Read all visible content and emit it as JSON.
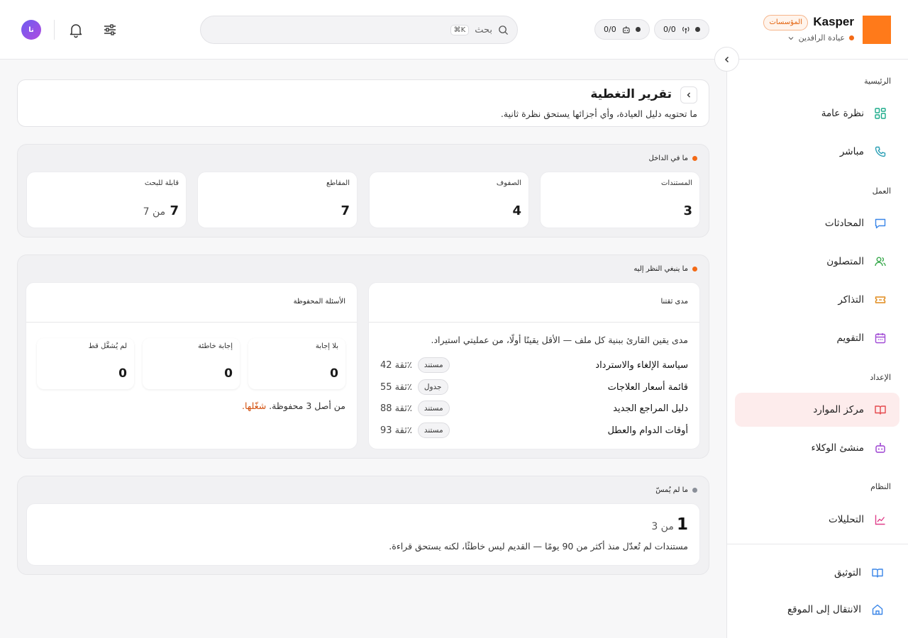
{
  "topbar": {
    "brand_name": "Kasper",
    "brand_badge": "المؤسسات",
    "workspace": "عيادة الرافدين",
    "status": [
      {
        "value": "0/0",
        "icon": "antenna-icon"
      },
      {
        "value": "0/0",
        "icon": "bot-icon"
      }
    ],
    "search_placeholder": "بحث",
    "search_shortcut": "⌘K",
    "avatar_initials": "نا"
  },
  "sidebar": {
    "sections": {
      "home": "الرئيسية",
      "work": "العمل",
      "setup": "الإعداد",
      "system": "النظام"
    },
    "items": {
      "overview": "نظرة عامة",
      "live": "مباشر",
      "conversations": "المحادثات",
      "contacts": "المتصلون",
      "tickets": "التذاكر",
      "calendar": "التقويم",
      "resources": "مركز الموارد",
      "agent_builder": "منشئ الوكلاء",
      "analytics": "التحليلات",
      "docs": "التوثيق",
      "site": "الانتقال إلى الموقع"
    },
    "active": "resources"
  },
  "header": {
    "title": "تقرير التغطية",
    "subtitle": "ما تحتويه دليل العيادة، وأي أجزائها يستحق نظرة ثانية."
  },
  "inside": {
    "label": "ما في الداخل",
    "stats": [
      {
        "label": "المستندات",
        "value": "3",
        "sub": ""
      },
      {
        "label": "الصفوف",
        "value": "4",
        "sub": ""
      },
      {
        "label": "المقاطع",
        "value": "7",
        "sub": ""
      },
      {
        "label": "قابلة للبحث",
        "value": "7",
        "sub": "من 7"
      }
    ]
  },
  "attention": {
    "label": "ما ينبغي النظر إليه",
    "confidence": {
      "title": "مدى ثقتنا",
      "intro": "مدى يقين القارئ ببنية كل ملف — الأقل يقينًا أولًا، من عمليتي استيراد.",
      "rows": [
        {
          "name": "سياسة الإلغاء والاسترداد",
          "tag": "مستند",
          "pct": "ثقة 42٪"
        },
        {
          "name": "قائمة أسعار العلاجات",
          "tag": "جدول",
          "pct": "ثقة 55٪"
        },
        {
          "name": "دليل المراجع الجديد",
          "tag": "مستند",
          "pct": "ثقة 88٪"
        },
        {
          "name": "أوقات الدوام والعطل",
          "tag": "مستند",
          "pct": "ثقة 93٪"
        }
      ]
    },
    "saved": {
      "title": "الأسئلة المحفوظة",
      "cards": [
        {
          "label": "بلا إجابة",
          "value": "0"
        },
        {
          "label": "إجابة خاطئة",
          "value": "0"
        },
        {
          "label": "لم يُشغَّل قط",
          "value": "0"
        }
      ],
      "note": "من أصل 3 محفوظة.",
      "note_link": "شغّلها."
    }
  },
  "untouched": {
    "label": "ما لم يُمسّ",
    "value": "1",
    "of": "من 3",
    "desc": "مستندات لم تُعدّل منذ أكثر من 90 يومًا — القديم ليس خاطئًا، لكنه يستحق قراءة."
  },
  "colors": {
    "brand": "#ff7a1a",
    "accent": "#d24e0b",
    "active_bg": "#fdecec"
  }
}
